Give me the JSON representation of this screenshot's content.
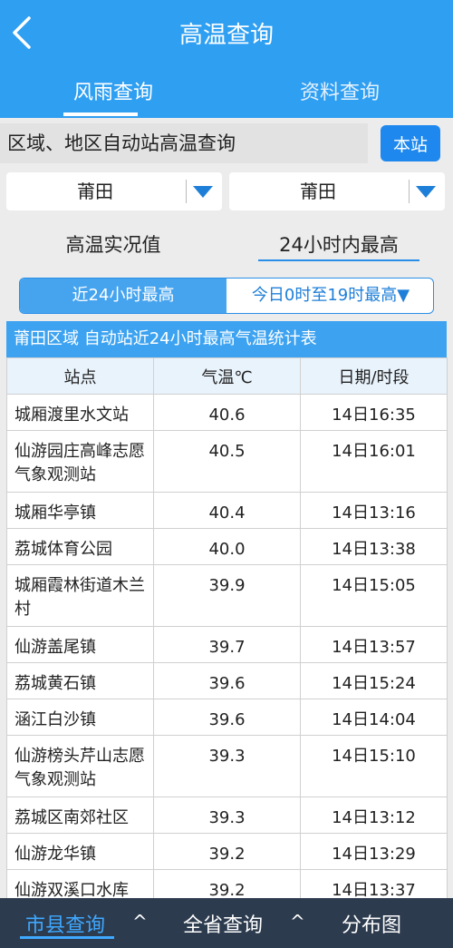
{
  "header": {
    "title": "高温查询"
  },
  "tabs": [
    {
      "label": "风雨查询",
      "active": true
    },
    {
      "label": "资料查询",
      "active": false
    }
  ],
  "query": {
    "label": "区域、地区自动站高温查询",
    "local_button": "本站"
  },
  "selects": {
    "region": "莆田",
    "area": "莆田"
  },
  "modes": {
    "left": "高温实况值",
    "right": "24小时内最高"
  },
  "segment": {
    "left": "近24小时最高",
    "right": "今日0时至19时最高▼"
  },
  "table": {
    "caption": "莆田区域 自动站近24小时最高气温统计表",
    "headers": [
      "站点",
      "气温℃",
      "日期/时段"
    ],
    "rows": [
      [
        "城厢渡里水文站",
        "40.6",
        "14日16:35"
      ],
      [
        "仙游园庄高峰志愿气象观测站",
        "40.5",
        "14日16:01"
      ],
      [
        "城厢华亭镇",
        "40.4",
        "14日13:16"
      ],
      [
        "荔城体育公园",
        "40.0",
        "14日13:38"
      ],
      [
        "城厢霞林街道木兰村",
        "39.9",
        "14日15:05"
      ],
      [
        "仙游盖尾镇",
        "39.7",
        "14日13:57"
      ],
      [
        "荔城黄石镇",
        "39.6",
        "14日15:24"
      ],
      [
        "涵江白沙镇",
        "39.6",
        "14日14:04"
      ],
      [
        "仙游榜头芹山志愿气象观测站",
        "39.3",
        "14日15:10"
      ],
      [
        "荔城区南郊社区",
        "39.3",
        "14日13:12"
      ],
      [
        "仙游龙华镇",
        "39.2",
        "14日13:29"
      ],
      [
        "仙游双溪口水库",
        "39.2",
        "14日13:37"
      ]
    ]
  },
  "bottom_nav": [
    {
      "label": "市县查询",
      "active": true,
      "caret": "^"
    },
    {
      "label": "全省查询",
      "active": false,
      "caret": "^"
    },
    {
      "label": "分布图",
      "active": false
    }
  ],
  "colors": {
    "header": "#2f9ff2",
    "accent": "#1e88ee",
    "bottom_bar": "#2d3b4e"
  },
  "icons": {
    "back": "chevron-left-icon",
    "dropdown": "triangle-down-icon",
    "caret": "chevron-up-icon"
  }
}
